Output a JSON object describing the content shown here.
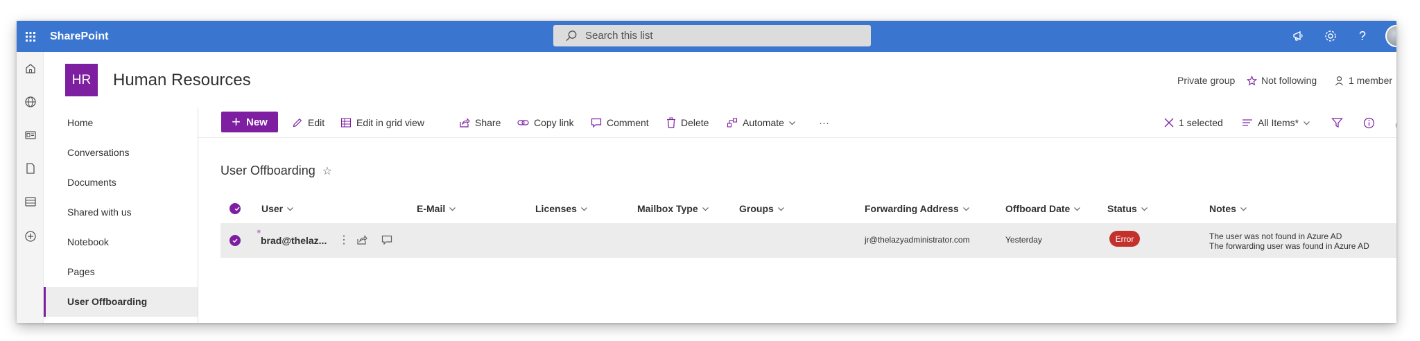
{
  "suite": {
    "app_name": "SharePoint",
    "search_placeholder": "Search this list"
  },
  "site": {
    "logo_initials": "HR",
    "title": "Human Resources",
    "privacy": "Private group",
    "follow": "Not following",
    "members": "1 member"
  },
  "nav": {
    "items": [
      {
        "label": "Home"
      },
      {
        "label": "Conversations"
      },
      {
        "label": "Documents"
      },
      {
        "label": "Shared with us"
      },
      {
        "label": "Notebook"
      },
      {
        "label": "Pages"
      },
      {
        "label": "User Offboarding",
        "active": true
      }
    ]
  },
  "commands": {
    "new": "New",
    "edit": "Edit",
    "edit_grid": "Edit in grid view",
    "share": "Share",
    "copy_link": "Copy link",
    "comment": "Comment",
    "delete": "Delete",
    "automate": "Automate",
    "more": "···",
    "selected": "1 selected",
    "view": "All Items*"
  },
  "list": {
    "title": "User Offboarding",
    "columns": [
      "User",
      "E-Mail",
      "Licenses",
      "Mailbox Type",
      "Groups",
      "Forwarding Address",
      "Offboard Date",
      "Status",
      "Notes"
    ],
    "rows": [
      {
        "user": "brad@thelaz...",
        "email": "",
        "forwarding": "jr@thelazyadministrator.com",
        "offboard_date": "Yesterday",
        "status": "Error",
        "notes": [
          "The user was not found in Azure AD",
          "The forwarding user was found in Azure AD"
        ]
      }
    ]
  },
  "colors": {
    "suite_bar": "#3a76cf",
    "accent": "#7d1fa0",
    "error": "#c4312d"
  }
}
